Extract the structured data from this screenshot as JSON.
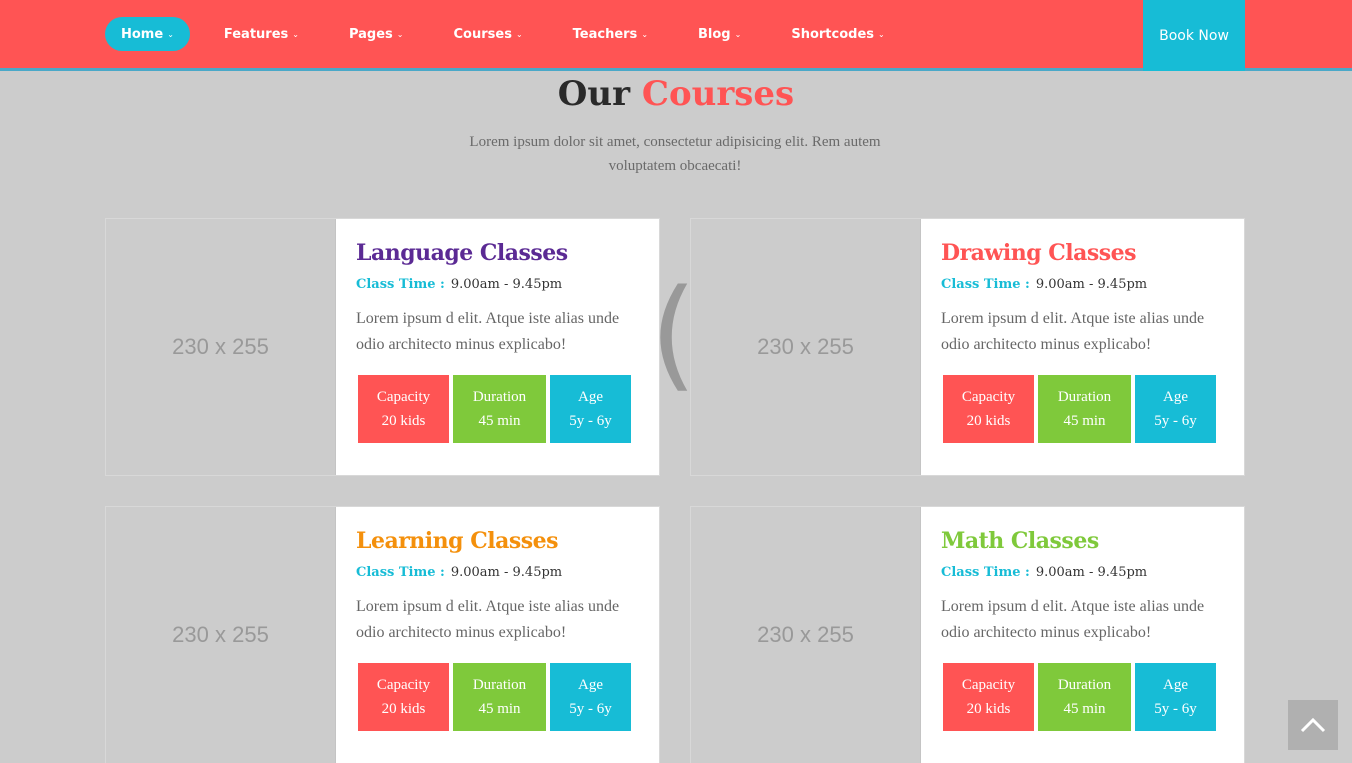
{
  "nav": {
    "items": [
      {
        "label": "Home",
        "active": true
      },
      {
        "label": "Features",
        "active": false
      },
      {
        "label": "Pages",
        "active": false
      },
      {
        "label": "Courses",
        "active": false
      },
      {
        "label": "Teachers",
        "active": false
      },
      {
        "label": "Blog",
        "active": false
      },
      {
        "label": "Shortcodes",
        "active": false
      }
    ],
    "book_label": "Book Now",
    "chevron_icon": "chevron-down-icon"
  },
  "section": {
    "title_part1": "Our",
    "title_part2": "Courses",
    "subtitle": "Lorem ipsum dolor sit amet, consectetur adipisicing elit. Rem autem voluptatem obcaecati!"
  },
  "courses": [
    {
      "title": "Language Classes",
      "title_color": "#5b2a94",
      "image_label": "230 x 255",
      "time_label": "Class Time :",
      "time_value": "9.00am - 9.45pm",
      "description": "Lorem ipsum d elit. Atque iste alias unde odio architecto minus explicabo!",
      "capacity_label": "Capacity",
      "capacity_value": "20 kids",
      "duration_label": "Duration",
      "duration_value": "45 min",
      "age_label": "Age",
      "age_value": "5y - 6y"
    },
    {
      "title": "Drawing Classes",
      "title_color": "#ff5454",
      "image_label": "230 x 255",
      "time_label": "Class Time :",
      "time_value": "9.00am - 9.45pm",
      "description": "Lorem ipsum d elit. Atque iste alias unde odio architecto minus explicabo!",
      "capacity_label": "Capacity",
      "capacity_value": "20 kids",
      "duration_label": "Duration",
      "duration_value": "45 min",
      "age_label": "Age",
      "age_value": "5y - 6y"
    },
    {
      "title": "Learning Classes",
      "title_color": "#f4900c",
      "image_label": "230 x 255",
      "time_label": "Class Time :",
      "time_value": "9.00am - 9.45pm",
      "description": "Lorem ipsum d elit. Atque iste alias unde odio architecto minus explicabo!",
      "capacity_label": "Capacity",
      "capacity_value": "20 kids",
      "duration_label": "Duration",
      "duration_value": "45 min",
      "age_label": "Age",
      "age_value": "5y - 6y"
    },
    {
      "title": "Math Classes",
      "title_color": "#7fc93b",
      "image_label": "230 x 255",
      "time_label": "Class Time :",
      "time_value": "9.00am - 9.45pm",
      "description": "Lorem ipsum d elit. Atque iste alias unde odio architecto minus explicabo!",
      "capacity_label": "Capacity",
      "capacity_value": "20 kids",
      "duration_label": "Duration",
      "duration_value": "45 min",
      "age_label": "Age",
      "age_value": "5y - 6y"
    }
  ],
  "back_to_top_icon": "chevron-up-icon",
  "colors": {
    "brand": "#ff5454",
    "accent": "#17bcd6",
    "green": "#7fc93b"
  }
}
